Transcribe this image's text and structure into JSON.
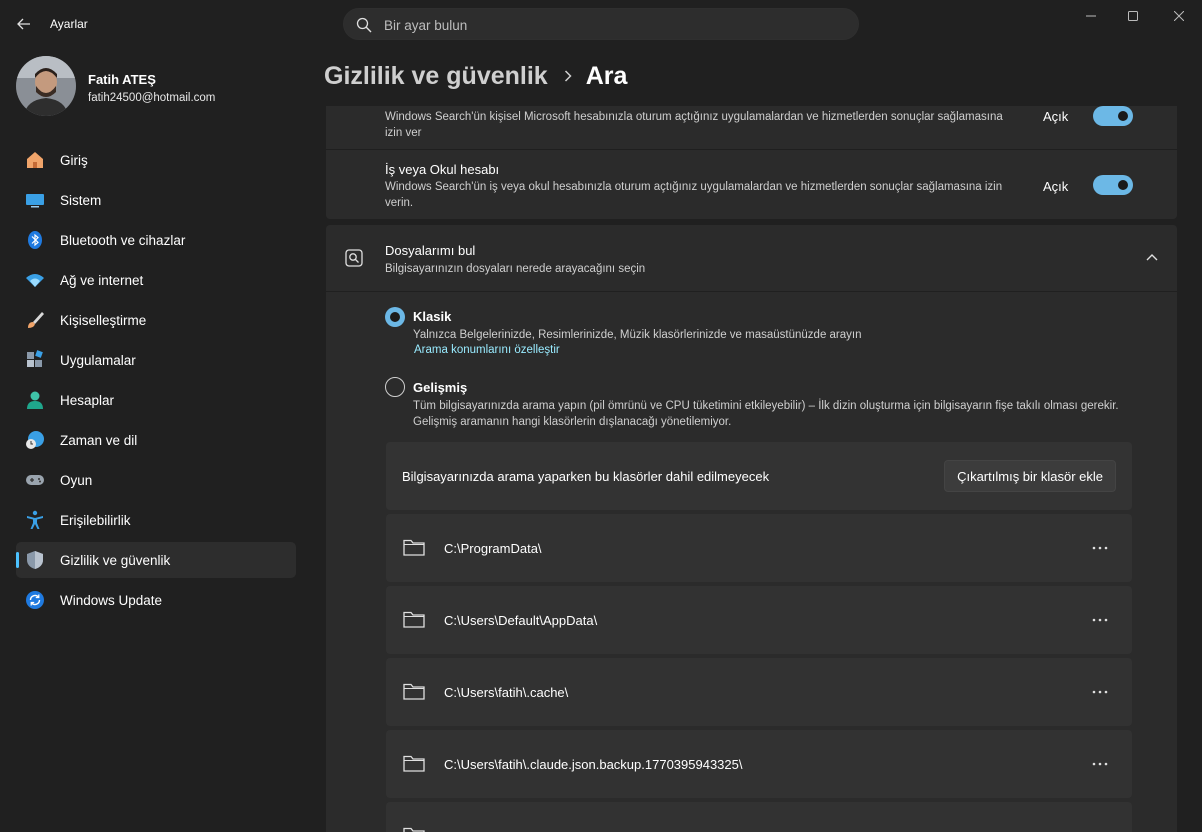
{
  "app": {
    "title": "Ayarlar"
  },
  "search": {
    "placeholder": "Bir ayar bulun"
  },
  "user": {
    "name": "Fatih ATEŞ",
    "email": "fatih24500@hotmail.com"
  },
  "sidebar": {
    "items": [
      {
        "label": "Giriş",
        "icon": "home-icon"
      },
      {
        "label": "Sistem",
        "icon": "monitor-icon"
      },
      {
        "label": "Bluetooth ve cihazlar",
        "icon": "bluetooth-icon"
      },
      {
        "label": "Ağ ve internet",
        "icon": "wifi-icon"
      },
      {
        "label": "Kişiselleştirme",
        "icon": "brush-icon"
      },
      {
        "label": "Uygulamalar",
        "icon": "apps-icon"
      },
      {
        "label": "Hesaplar",
        "icon": "person-icon"
      },
      {
        "label": "Zaman ve dil",
        "icon": "globe-clock-icon"
      },
      {
        "label": "Oyun",
        "icon": "gamepad-icon"
      },
      {
        "label": "Erişilebilirlik",
        "icon": "accessibility-icon"
      },
      {
        "label": "Gizlilik ve güvenlik",
        "icon": "shield-icon",
        "active": true
      },
      {
        "label": "Windows Update",
        "icon": "update-icon"
      }
    ]
  },
  "header": {
    "parent": "Gizlilik ve güvenlik",
    "current": "Ara"
  },
  "cloud_search": {
    "microsoft": {
      "desc": "Windows Search'ün kişisel Microsoft hesabınızla oturum açtığınız uygulamalardan ve hizmetlerden sonuçlar sağlamasına izin ver",
      "state": "Açık",
      "on": true
    },
    "work": {
      "title": "İş veya Okul hesabı",
      "desc": "Windows Search'ün iş veya okul hesabınızla oturum açtığınız uygulamalardan ve hizmetlerden sonuçlar sağlamasına izin verin.",
      "state": "Açık",
      "on": true
    }
  },
  "find_files": {
    "title": "Dosyalarımı bul",
    "subtitle": "Bilgisayarınızın dosyaları nerede arayacağını seçin",
    "classic": {
      "title": "Klasik",
      "desc": "Yalnızca Belgelerinizde, Resimlerinizde, Müzik klasörlerinizde ve masaüstünüzde arayın",
      "link": "Arama konumlarını özelleştir",
      "selected": true
    },
    "enhanced": {
      "title": "Gelişmiş",
      "desc": "Tüm bilgisayarınızda arama yapın (pil ömrünü ve CPU tüketimini etkileyebilir) – İlk dizin oluşturma için bilgisayarın fişe takılı olması gerekir. Gelişmiş aramanın hangi klasörlerin dışlanacağı yönetilemiyor.",
      "selected": false
    },
    "excluded": {
      "label": "Bilgisayarınızda arama yaparken bu klasörler dahil edilmeyecek",
      "add_button": "Çıkartılmış bir klasör ekle",
      "folders": [
        "C:\\ProgramData\\",
        "C:\\Users\\Default\\AppData\\",
        "C:\\Users\\fatih\\.cache\\",
        "C:\\Users\\fatih\\.claude.json.backup.1770395943325\\"
      ]
    }
  },
  "colors": {
    "accent": "#6cb8e6",
    "link": "#99ebff",
    "background": "#202020",
    "card": "#2b2b2b"
  }
}
